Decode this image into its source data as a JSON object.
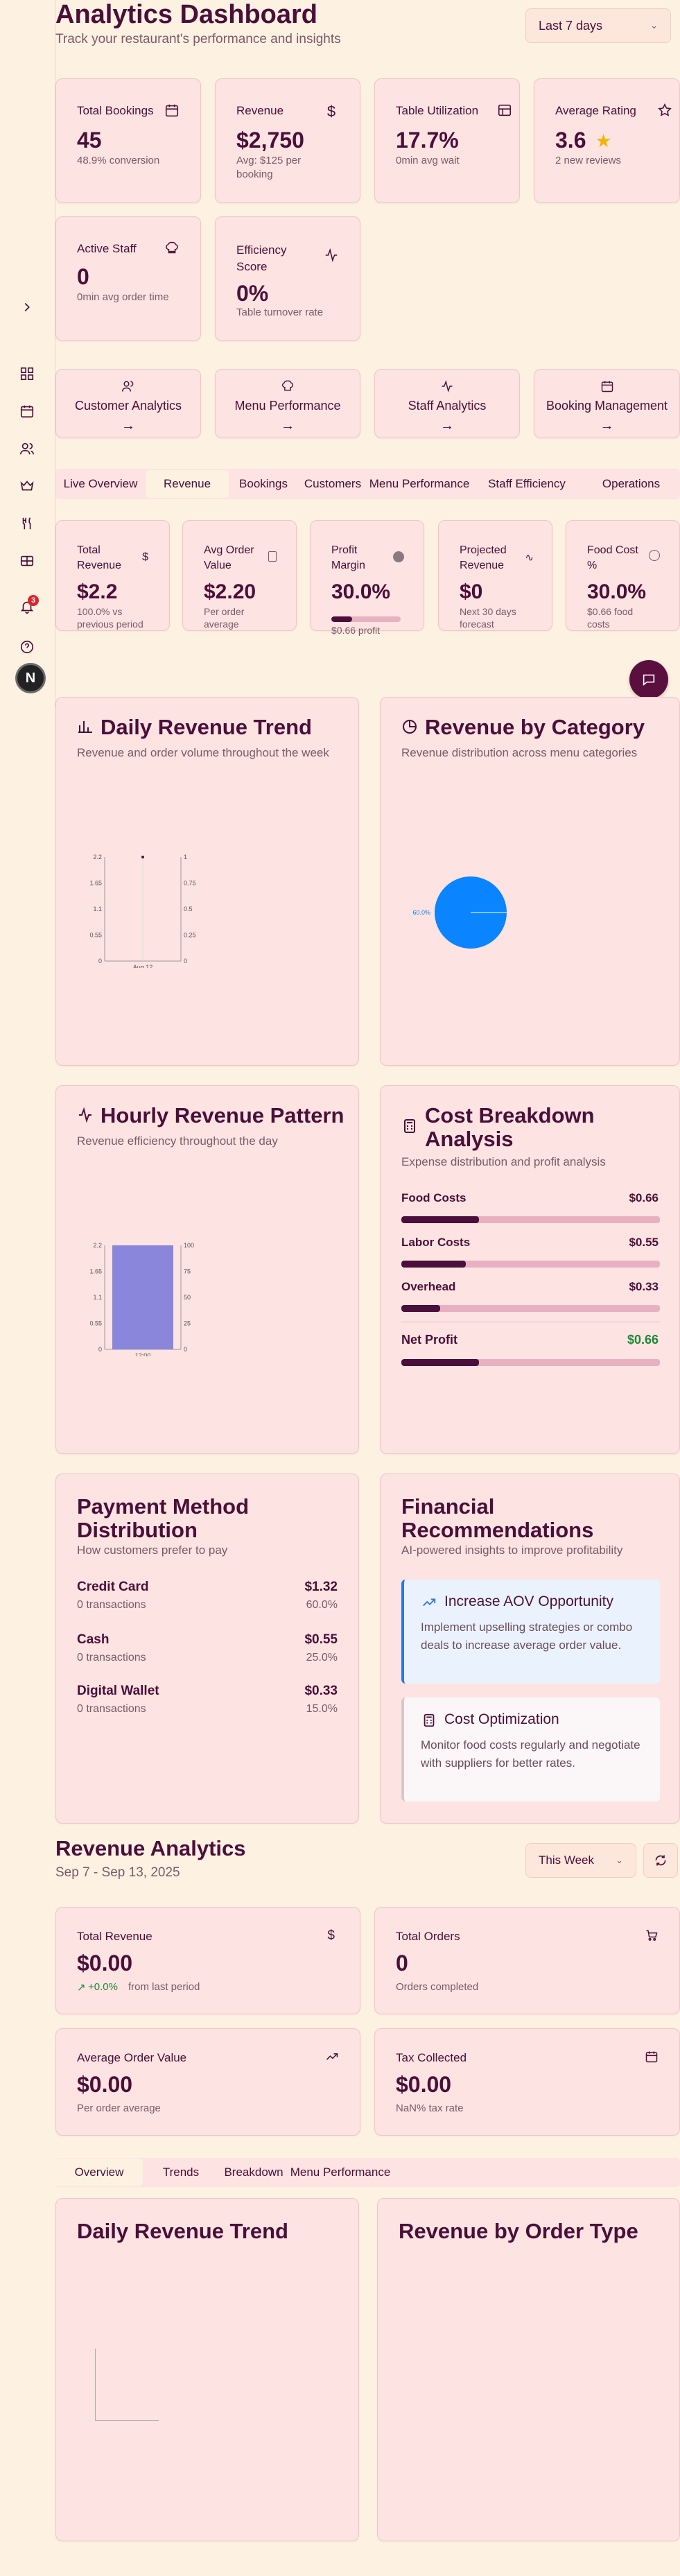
{
  "header": {
    "title": "Analytics Dashboard",
    "subtitle": "Track your restaurant's performance and insights",
    "range": "Last 7 days"
  },
  "kpis_row1": [
    {
      "title": "Total Bookings",
      "value": "45",
      "sub": "48.9% conversion",
      "icon": "calendar-icon"
    },
    {
      "title": "Revenue",
      "value": "$2,750",
      "sub": "Avg: $125 per booking",
      "icon": "dollar-icon"
    },
    {
      "title": "Table Utilization",
      "value": "17.7%",
      "sub": "0min avg wait",
      "icon": "table-icon"
    },
    {
      "title": "Average Rating",
      "value": "3.6",
      "sub": "2 new reviews",
      "icon": "star-icon"
    }
  ],
  "kpis_row2": [
    {
      "title": "Active Staff",
      "value": "0",
      "sub": "0min avg order time",
      "icon": "chef-hat-icon"
    },
    {
      "title": "Efficiency Score",
      "value": "0%",
      "sub": "Table turnover rate",
      "icon": "activity-icon"
    }
  ],
  "nav_cards": [
    {
      "label": "Customer Analytics",
      "arrow": "→",
      "icon": "users-icon"
    },
    {
      "label": "Menu Performance",
      "arrow": "→",
      "icon": "chef-hat-icon"
    },
    {
      "label": "Staff Analytics",
      "arrow": "→",
      "icon": "activity-icon"
    },
    {
      "label": "Booking Management",
      "arrow": "→",
      "icon": "calendar-icon"
    }
  ],
  "tabs": [
    "Live Overview",
    "Revenue",
    "Bookings",
    "Customers",
    "Menu Performance",
    "Staff Efficiency",
    "Operations"
  ],
  "revenue_kpis": [
    {
      "title": "Total Revenue",
      "value": "$2.2",
      "sub": "100.0% vs previous period"
    },
    {
      "title": "Avg Order Value",
      "value": "$2.20",
      "sub": "Per order average"
    },
    {
      "title": "Profit Margin",
      "value": "30.0%",
      "sub": "$0.66 profit",
      "progress": 0.3
    },
    {
      "title": "Projected Revenue",
      "value": "$0",
      "sub": "Next 30 days forecast"
    },
    {
      "title": "Food Cost %",
      "value": "30.0%",
      "sub": "$0.66 food costs"
    }
  ],
  "daily_trend": {
    "title": "Daily Revenue Trend",
    "sub": "Revenue and order volume throughout the week"
  },
  "category": {
    "title": "Revenue by Category",
    "sub": "Revenue distribution across menu categories",
    "slice_label": "60.0%"
  },
  "hourly": {
    "title": "Hourly Revenue Pattern",
    "sub": "Revenue efficiency throughout the day"
  },
  "cost": {
    "title": "Cost Breakdown Analysis",
    "sub": "Expense distribution and profit analysis",
    "rows": [
      {
        "label": "Food Costs",
        "value": "$0.66",
        "fraction": 0.3
      },
      {
        "label": "Labor Costs",
        "value": "$0.55",
        "fraction": 0.25
      },
      {
        "label": "Overhead",
        "value": "$0.33",
        "fraction": 0.15
      }
    ],
    "net": {
      "label": "Net Profit",
      "value": "$0.66",
      "fraction": 0.3
    }
  },
  "payments": {
    "title": "Payment Method Distribution",
    "sub": "How customers prefer to pay",
    "rows": [
      {
        "name": "Credit Card",
        "tx": "0 transactions",
        "amount": "$1.32",
        "pct": "60.0%"
      },
      {
        "name": "Cash",
        "tx": "0 transactions",
        "amount": "$0.55",
        "pct": "25.0%"
      },
      {
        "name": "Digital Wallet",
        "tx": "0 transactions",
        "amount": "$0.33",
        "pct": "15.0%"
      }
    ]
  },
  "recs": {
    "title": "Financial Recommendations",
    "sub": "AI-powered insights to improve profitability",
    "items": [
      {
        "title": "Increase AOV Opportunity",
        "body": "Implement upselling strategies or combo deals to increase average order value."
      },
      {
        "title": "Cost Optimization",
        "body": "Monitor food costs regularly and negotiate with suppliers for better rates."
      }
    ]
  },
  "rev_analytics": {
    "title": "Revenue Analytics",
    "dates": "Sep 7 - Sep 13, 2025",
    "period": "This Week",
    "cards": [
      {
        "title": "Total Revenue",
        "value": "$0.00",
        "trend": "+0.0%",
        "sub": "from last period",
        "icon": "dollar-icon"
      },
      {
        "title": "Total Orders",
        "value": "0",
        "sub": "Orders completed",
        "icon": "cart-icon"
      },
      {
        "title": "Average Order Value",
        "value": "$0.00",
        "sub": "Per order average",
        "icon": "trending-up-icon"
      },
      {
        "title": "Tax Collected",
        "value": "$0.00",
        "sub": "NaN% tax rate",
        "icon": "calendar-icon"
      }
    ],
    "tabs": [
      "Overview",
      "Trends",
      "Breakdown",
      "Menu Performance"
    ],
    "panel_left": "Daily Revenue Trend",
    "panel_right": "Revenue by Order Type"
  },
  "notifications": {
    "count": "3"
  },
  "avatar": {
    "letter": "N"
  },
  "chart_data": [
    {
      "type": "line",
      "title": "Daily Revenue Trend",
      "x": [
        "Aug 12"
      ],
      "series": [
        {
          "values": [
            2.2
          ],
          "axis": "left"
        },
        {
          "values": [
            1
          ],
          "axis": "right"
        }
      ],
      "left_ticks": [
        "0",
        "0.55",
        "1.1",
        "1.65",
        "2.2"
      ],
      "right_ticks": [
        "0",
        "0.25",
        "0.5",
        "0.75",
        "1"
      ],
      "ylim_left": [
        0,
        2.2
      ],
      "ylim_right": [
        0,
        1
      ]
    },
    {
      "type": "pie",
      "title": "Revenue by Category",
      "slices": [
        {
          "value": 100,
          "label": "60.0%",
          "color": "#0a84ff"
        }
      ]
    },
    {
      "type": "bar",
      "title": "Hourly Revenue Pattern",
      "categories": [
        "12:00"
      ],
      "values": [
        2.2
      ],
      "left_ticks": [
        "0",
        "0.55",
        "1.1",
        "1.65",
        "2.2"
      ],
      "right_ticks": [
        "0",
        "25",
        "50",
        "75",
        "100"
      ],
      "ylim_left": [
        0,
        2.2
      ],
      "ylim_right": [
        0,
        100
      ],
      "color": "#8a86dc"
    }
  ]
}
